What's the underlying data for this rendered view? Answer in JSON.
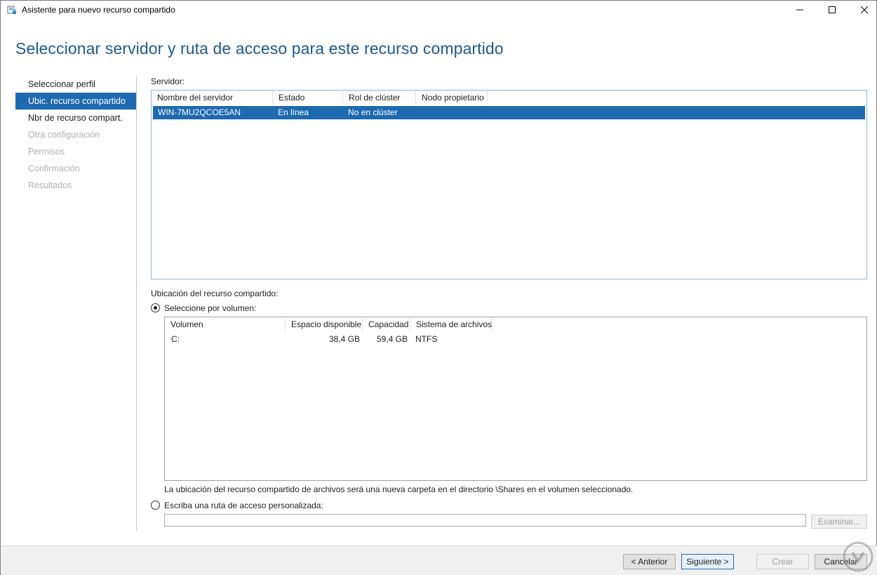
{
  "window": {
    "title": "Asistente para nuevo recurso compartido",
    "icon": "share-wizard-icon"
  },
  "heading": "Seleccionar servidor y ruta de acceso para este recurso compartido",
  "nav": {
    "items": [
      {
        "label": "Seleccionar perfil",
        "state": "normal"
      },
      {
        "label": "Ubic. recurso compartido",
        "state": "selected"
      },
      {
        "label": "Nbr de recurso compart.",
        "state": "normal"
      },
      {
        "label": "Otra configuración",
        "state": "disabled"
      },
      {
        "label": "Permisos",
        "state": "disabled"
      },
      {
        "label": "Confirmación",
        "state": "disabled"
      },
      {
        "label": "Resultados",
        "state": "disabled"
      }
    ]
  },
  "server": {
    "label": "Servidor:",
    "columns": [
      "Nombre del servidor",
      "Estado",
      "Rol de clúster",
      "Nodo propietario"
    ],
    "rows": [
      {
        "name": "WIN-7MU2QCOE5AN",
        "status": "En línea",
        "cluster_role": "No en clúster",
        "owner_node": "",
        "selected": true
      }
    ]
  },
  "location": {
    "label": "Ubicación del recurso compartido:",
    "by_volume": {
      "label": "Seleccione por volumen:",
      "checked": true
    },
    "volume_columns": [
      "Volumen",
      "Espacio disponible",
      "Capacidad",
      "Sistema de archivos"
    ],
    "volumes": [
      {
        "volume": "C:",
        "free": "38,4 GB",
        "capacity": "59,4 GB",
        "fs": "NTFS"
      }
    ],
    "note": "La ubicación del recurso compartido de archivos será una nueva carpeta en el directorio \\Shares en el volumen seleccionado.",
    "custom_path": {
      "label": "Escriba una ruta de acceso personalizada:",
      "checked": false,
      "value": "",
      "browse_label": "Examinar..."
    }
  },
  "footer": {
    "back_label": "< Anterior",
    "next_label": "Siguiente >",
    "create_label": "Crear",
    "cancel_label": "Cancelar"
  },
  "colors": {
    "accent": "#1e6ab0",
    "heading": "#1e5a8c",
    "disabled_text": "#b0b0b0"
  }
}
